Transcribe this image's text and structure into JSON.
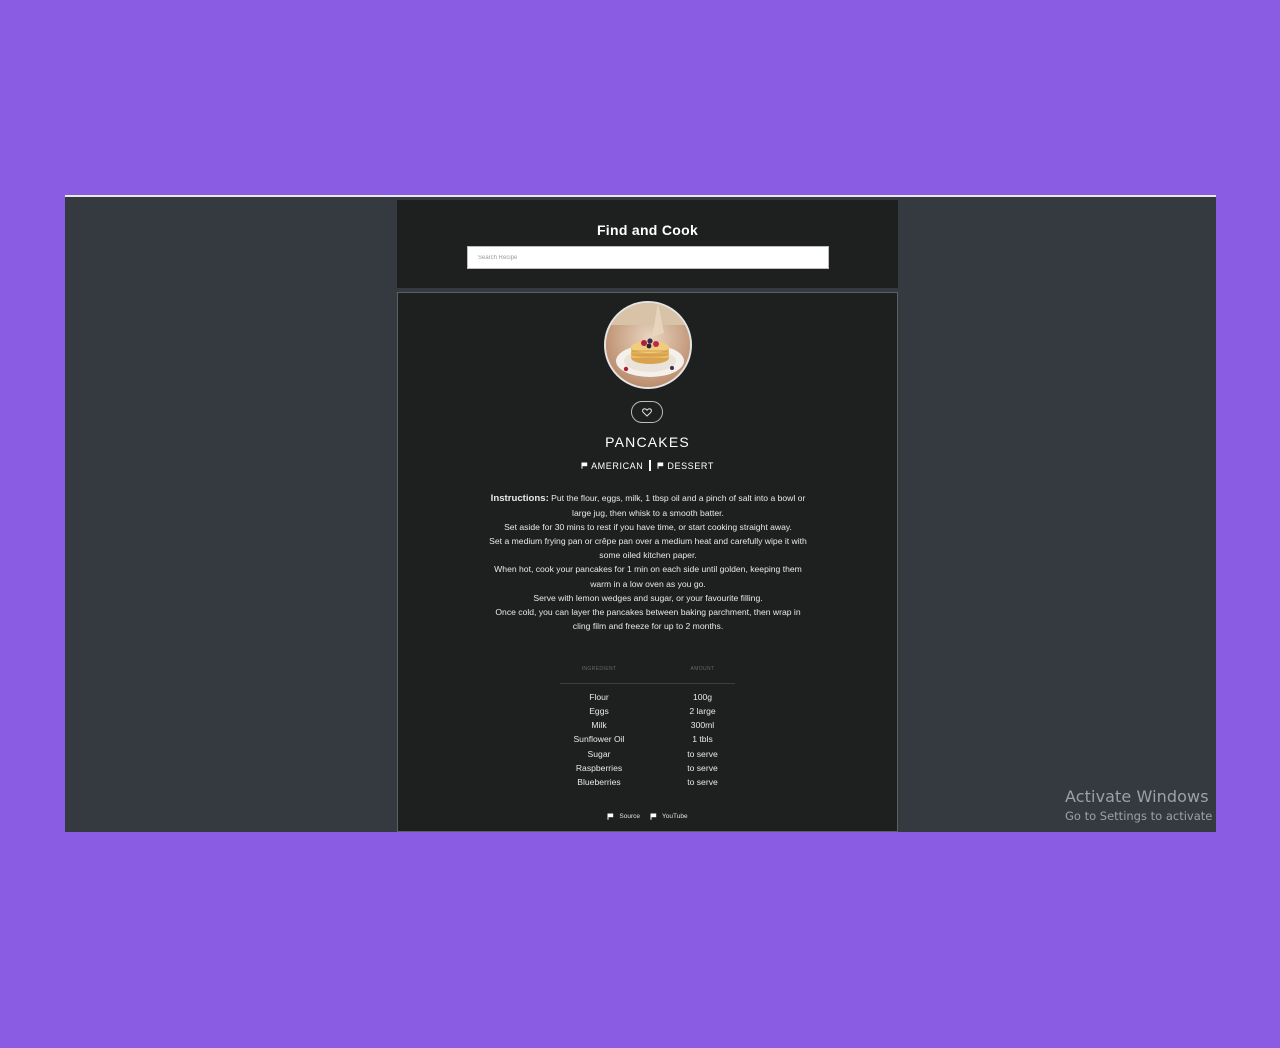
{
  "app": {
    "title": "Find and Cook"
  },
  "search": {
    "placeholder": "Search Recipe"
  },
  "recipe": {
    "image_alt": "pancakes-photo",
    "title": "PANCAKES",
    "area": "AMERICAN",
    "category": "DESSERT",
    "instructions_label": "Instructions:",
    "instructions": [
      "Put the flour, eggs, milk, 1 tbsp oil and a pinch of salt into a bowl or large jug, then whisk to a smooth batter.",
      "Set aside for 30 mins to rest if you have time, or start cooking straight away.",
      "Set a medium frying pan or crêpe pan over a medium heat and carefully wipe it with some oiled kitchen paper.",
      "When hot, cook your pancakes for 1 min on each side until golden, keeping them warm in a low oven as you go.",
      "Serve with lemon wedges and sugar, or your favourite filling.",
      "Once cold, you can layer the pancakes between baking parchment, then wrap in cling film and freeze for up to 2 months."
    ],
    "table_headers": {
      "ingredient": "Ingredient",
      "amount": "Amount"
    },
    "ingredients": [
      {
        "name": "Flour",
        "amount": "100g"
      },
      {
        "name": "Eggs",
        "amount": "2 large"
      },
      {
        "name": "Milk",
        "amount": "300ml"
      },
      {
        "name": "Sunflower Oil",
        "amount": "1 tbls"
      },
      {
        "name": "Sugar",
        "amount": "to serve"
      },
      {
        "name": "Raspberries",
        "amount": "to serve"
      },
      {
        "name": "Blueberries",
        "amount": "to serve"
      }
    ],
    "links": {
      "source": "Source",
      "youtube": "YouTube"
    }
  },
  "watermark": {
    "title": "Activate Windows",
    "subtitle": "Go to Settings to activate Windows."
  }
}
